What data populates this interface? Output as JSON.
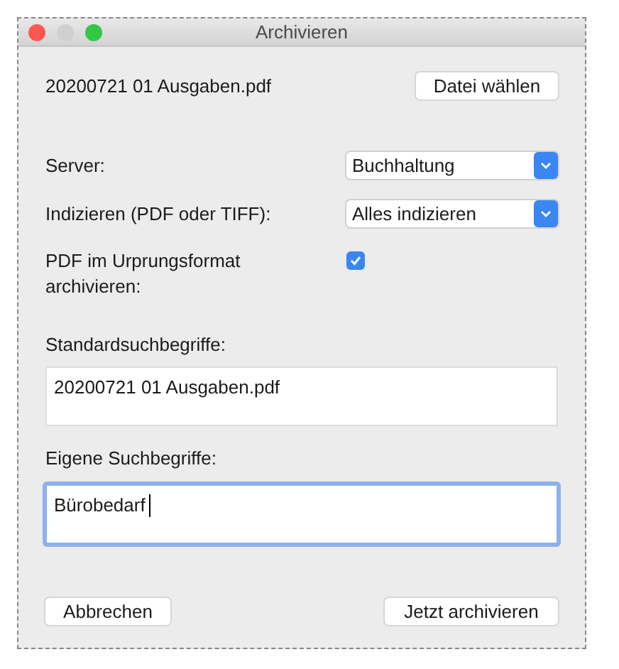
{
  "window": {
    "title": "Archivieren"
  },
  "file": {
    "name": "20200721 01 Ausgaben.pdf",
    "button": "Datei wählen"
  },
  "settings": [
    {
      "kind": "select",
      "label": "Server:",
      "value": "Buchhaltung"
    },
    {
      "kind": "select",
      "label": "Indizieren (PDF oder TIFF):",
      "value": "Alles indizieren"
    },
    {
      "kind": "checkbox",
      "label": "PDF im Urprungsformat archivieren:",
      "checked": true
    }
  ],
  "search_fields": [
    {
      "label": "Standardsuchbegriffe:",
      "value": "20200721 01 Ausgaben.pdf",
      "focused": false
    },
    {
      "label": "Eigene Suchbegriffe:",
      "value": "Bürobedarf",
      "focused": true
    }
  ],
  "buttons": [
    "Abbrechen",
    "Jetzt archivieren"
  ]
}
